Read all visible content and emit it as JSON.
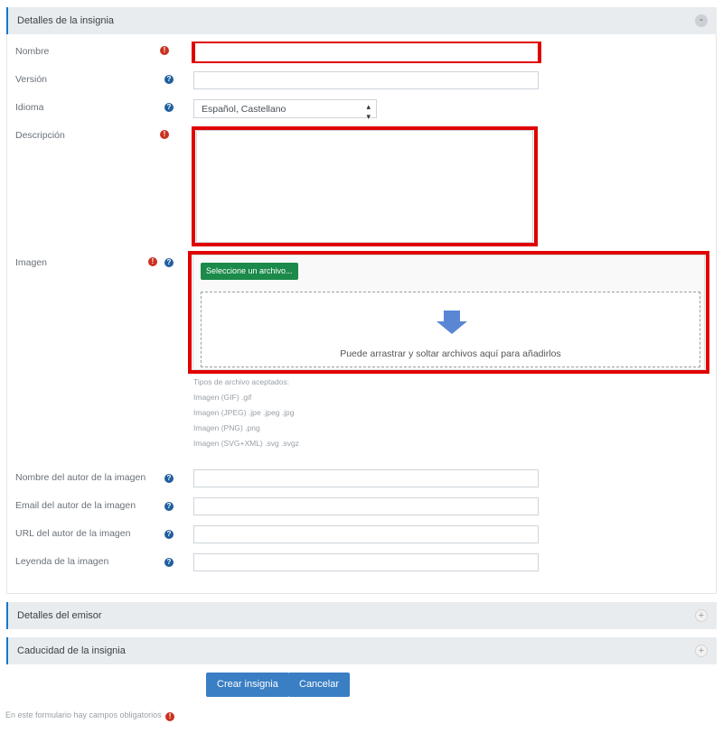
{
  "sections": {
    "badge_details": {
      "title": "Detalles de la insignia",
      "toggle": "-"
    },
    "issuer_details": {
      "title": "Detalles del emisor",
      "toggle": "+"
    },
    "expiry": {
      "title": "Caducidad de la insignia",
      "toggle": "+"
    }
  },
  "fields": {
    "name": {
      "label": "Nombre",
      "value": ""
    },
    "version": {
      "label": "Versión",
      "value": ""
    },
    "language": {
      "label": "Idioma",
      "selected": "Español, Castellano"
    },
    "description": {
      "label": "Descripción",
      "value": ""
    },
    "image": {
      "label": "Imagen"
    },
    "image_author_name": {
      "label": "Nombre del autor de la imagen",
      "value": ""
    },
    "image_author_email": {
      "label": "Email del autor de la imagen",
      "value": ""
    },
    "image_author_url": {
      "label": "URL del autor de la imagen",
      "value": ""
    },
    "image_caption": {
      "label": "Leyenda de la imagen",
      "value": ""
    }
  },
  "file_picker": {
    "button_label": "Seleccione un archivo...",
    "drop_text": "Puede arrastrar y soltar archivos aquí para añadirlos",
    "accepted_title": "Tipos de archivo aceptados:",
    "accepted": [
      "Imagen (GIF) .gif",
      "Imagen (JPEG) .jpe .jpeg .jpg",
      "Imagen (PNG) .png",
      "Imagen (SVG+XML) .svg .svgz"
    ]
  },
  "buttons": {
    "create": "Crear insignia",
    "cancel": "Cancelar"
  },
  "footer": {
    "required_note": "En este formulario hay campos obligatorios"
  },
  "icons": {
    "required": "!",
    "help": "?"
  },
  "colors": {
    "required": "#ca3120",
    "help": "#1f5f9e",
    "highlight": "#e00000",
    "primary": "#3a7ec4",
    "file_button": "#1b8a4a"
  }
}
